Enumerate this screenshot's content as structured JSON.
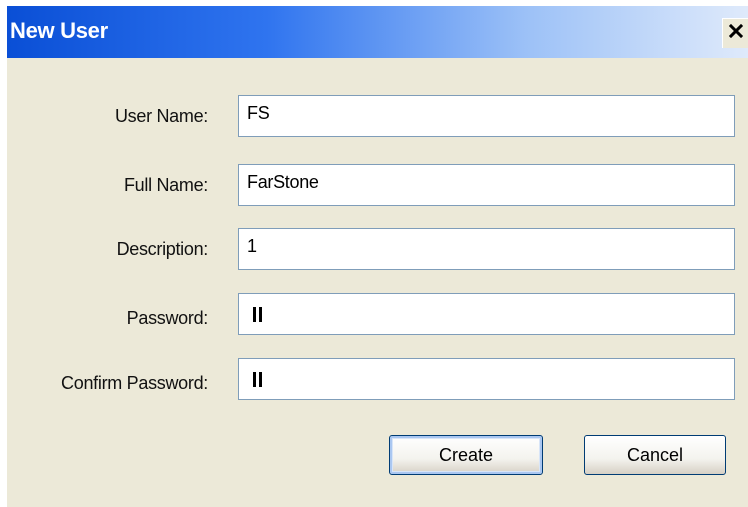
{
  "window": {
    "title": "New User",
    "close_glyph": "×"
  },
  "form": {
    "username_label": "User Name:",
    "username_value": "FS",
    "fullname_label": "Full Name:",
    "fullname_value": "FarStone",
    "description_label": "Description:",
    "description_value": "1",
    "password_label": "Password:",
    "password_mask_length": 2,
    "confirm_label": "Confirm Password:",
    "confirm_mask_length": 2
  },
  "buttons": {
    "create_label": "Create",
    "cancel_label": "Cancel"
  },
  "colors": {
    "titlebar_start": "#0a4fd6",
    "titlebar_end": "#dfeafb",
    "dialog_bg": "#ece9d8",
    "field_border": "#7f9db9",
    "button_border": "#003c74"
  },
  "icons": {
    "close": "close-icon"
  }
}
